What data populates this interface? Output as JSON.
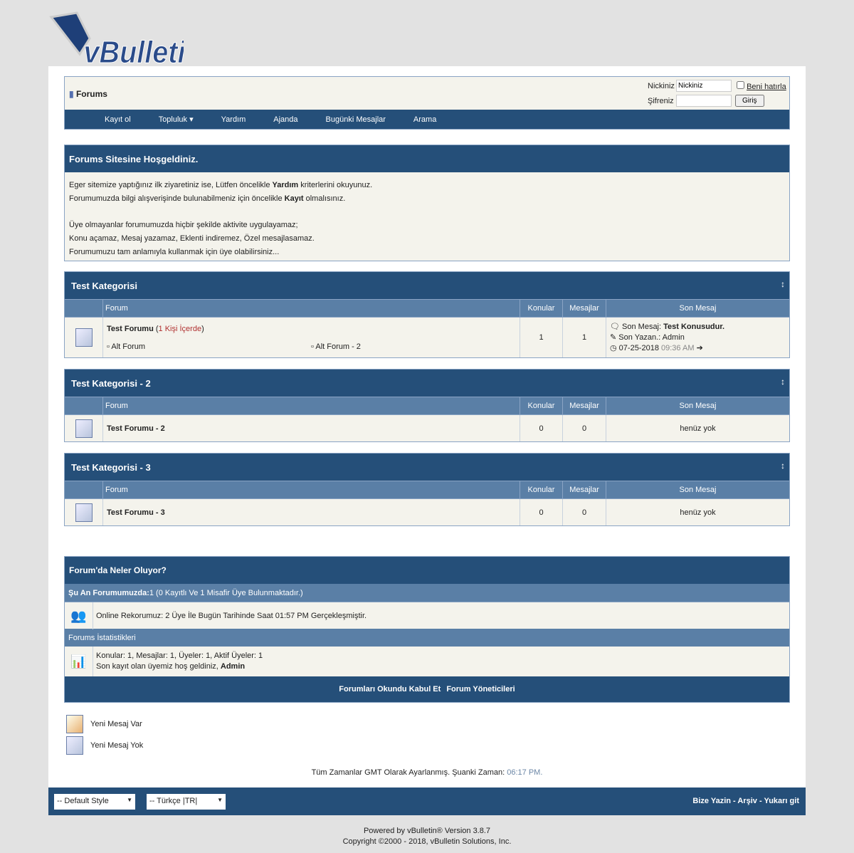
{
  "logo": "vBulletin",
  "header": {
    "title": "Forums",
    "nick_label": "Nickiniz",
    "nick_value": "Nickiniz",
    "pass_label": "Şifreniz",
    "remember": "Beni hatırla",
    "login": "Giriş"
  },
  "nav": [
    "Kayıt ol",
    "Topluluk",
    "Yardım",
    "Ajanda",
    "Bugünki Mesajlar",
    "Arama"
  ],
  "welcome": {
    "title": "Forums Sitesine Hoşgeldiniz.",
    "l1a": "Eger sitemize yaptığınız ilk ziyaretiniz ise, Lütfen öncelikle ",
    "l1b": "Yardım",
    "l1c": " kriterlerini okuyunuz.",
    "l2a": "Forumumuzda bilgi alışverişinde bulunabilmeniz için öncelikle ",
    "l2b": "Kayıt",
    "l2c": " olmalısınız.",
    "l3": "Üye olmayanlar forumumuzda hiçbir şekilde aktivite uygulayamaz;",
    "l4": "Konu açamaz, Mesaj yazamaz, Eklenti indiremez, Özel mesajlasamaz.",
    "l5": "Forumumuzu tam anlamıyla kullanmak için üye olabilirsiniz..."
  },
  "columns": {
    "forum": "Forum",
    "topics": "Konular",
    "posts": "Mesajlar",
    "last": "Son Mesaj"
  },
  "categories": [
    {
      "title": "Test Kategorisi",
      "forum": "Test Forumu",
      "viewers": "1 Kişi İçerde",
      "sub1": "Alt Forum",
      "sub2": "Alt Forum - 2",
      "topics": "1",
      "posts": "1",
      "last_label": "Son Mesaj:",
      "last_title": "Test Konusudur.",
      "author_label": "Son Yazan.:",
      "author": "Admin",
      "date": "07-25-2018",
      "time": "09:36 AM"
    },
    {
      "title": "Test Kategorisi - 2",
      "forum": "Test Forumu - 2",
      "topics": "0",
      "posts": "0",
      "last": "henüz yok"
    },
    {
      "title": "Test Kategorisi - 3",
      "forum": "Test Forumu - 3",
      "topics": "0",
      "posts": "0",
      "last": "henüz yok"
    }
  ],
  "whats": {
    "title": "Forum'da Neler Oluyor?",
    "online_label": "Şu An Forumumuzda:",
    "online": " 1 (0 Kayıtlı Ve 1 Misafir Üye Bulunmaktadır.)",
    "record": "Online Rekorumuz: 2 Üye İle Bugün Tarihinde Saat 01:57 PM Gerçekleşmiştir.",
    "stats_title": "Forums İstatistikleri",
    "stats": "Konular: 1, Mesajlar: 1, Üyeler: 1, Aktif Üyeler: 1",
    "newest": "Son kayıt olan üyemiz hoş geldiniz, ",
    "newest_user": "Admin",
    "mark_read": "Forumları Okundu Kabul Et",
    "mods": "Forum Yöneticileri"
  },
  "legend": {
    "new": "Yeni Mesaj Var",
    "none": "Yeni Mesaj Yok"
  },
  "time": {
    "text": "Tüm Zamanlar GMT Olarak Ayarlanmış. Şuanki Zaman: ",
    "value": "06:17 PM."
  },
  "footer": {
    "style": "-- Default Style",
    "lang": "-- Türkçe |TR|",
    "contact": "Bize Yazin",
    "archive": "Arşiv",
    "top": "Yukarı git",
    "powered": "Powered by vBulletin® Version 3.8.7",
    "copyright": "Copyright ©2000 - 2018, vBulletin Solutions, Inc."
  },
  "colors": {
    "dark": "#254f79",
    "light": "#5a7fa6",
    "cell": "#f4f3ec",
    "viewers": "#b03030"
  }
}
